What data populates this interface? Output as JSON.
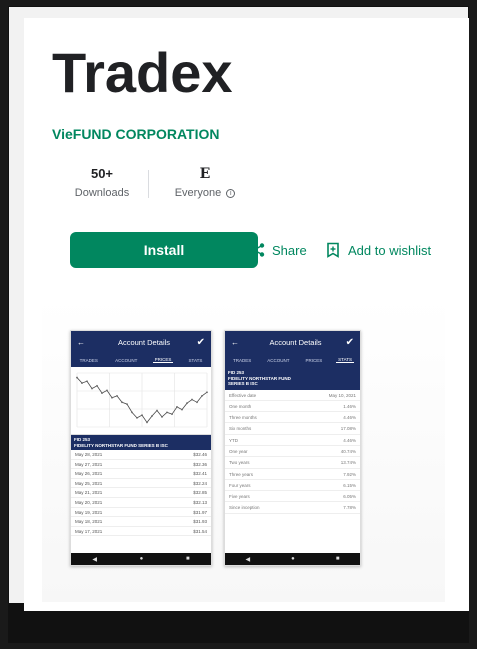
{
  "app": {
    "title": "Tradex",
    "developer": "VieFUND CORPORATION"
  },
  "stats": {
    "downloads_value": "50+",
    "downloads_label": "Downloads",
    "rating_badge": "E",
    "rating_label": "Everyone",
    "info_glyph": "i"
  },
  "actions": {
    "install_label": "Install",
    "share_label": "Share",
    "wishlist_label": "Add to wishlist"
  },
  "colors": {
    "accent": "#01875f",
    "phone_header": "#1c2e63"
  },
  "screenshots": {
    "prices": {
      "header_title": "Account Details",
      "back_glyph": "←",
      "check_glyph": "✔",
      "tabs": [
        "TRADES",
        "ACCOUNT",
        "PRICES",
        "STATS"
      ],
      "active_tab": "PRICES",
      "fund_line1": "FID 253",
      "fund_line2": "FIDELITY NORTHSTAR FUND SERIES B ISC",
      "rows": [
        {
          "date": "May 28, 2021",
          "price": "$32.46"
        },
        {
          "date": "May 27, 2021",
          "price": "$32.36"
        },
        {
          "date": "May 26, 2021",
          "price": "$32.41"
        },
        {
          "date": "May 25, 2021",
          "price": "$32.24"
        },
        {
          "date": "May 21, 2021",
          "price": "$32.85"
        },
        {
          "date": "May 20, 2021",
          "price": "$32.13"
        },
        {
          "date": "May 19, 2021",
          "price": "$31.97"
        },
        {
          "date": "May 18, 2021",
          "price": "$31.93"
        },
        {
          "date": "May 17, 2021",
          "price": "$31.54"
        }
      ],
      "chart_values": [
        34,
        33.4,
        33.6,
        32.8,
        33.1,
        32.3,
        32.6,
        31.8,
        32.0,
        31.3,
        31.1,
        30.2,
        29.6,
        29.9,
        29.1,
        29.8,
        30.4,
        29.7,
        30.2,
        30.0,
        30.8,
        30.5,
        31.2,
        31.6,
        31.3,
        32.0,
        32.4
      ]
    },
    "stats": {
      "header_title": "Account Details",
      "back_glyph": "←",
      "check_glyph": "✔",
      "tabs": [
        "TRADES",
        "ACCOUNT",
        "PRICES",
        "STATS"
      ],
      "active_tab": "STATS",
      "fund_line1": "FID 253",
      "fund_line2": "FIDELITY NORTHSTAR FUND",
      "fund_line3": "SERIES B ISC",
      "rows": [
        {
          "label": "Effective date",
          "value": "May 10, 2021"
        },
        {
          "label": "One month",
          "value": "1.46%"
        },
        {
          "label": "Three months",
          "value": "4.46%"
        },
        {
          "label": "Six months",
          "value": "17.08%"
        },
        {
          "label": "YTD",
          "value": "4.46%"
        },
        {
          "label": "One year",
          "value": "40.74%"
        },
        {
          "label": "Two years",
          "value": "13.74%"
        },
        {
          "label": "Three years",
          "value": "7.92%"
        },
        {
          "label": "Four years",
          "value": "6.15%"
        },
        {
          "label": "Five years",
          "value": "6.05%"
        },
        {
          "label": "Since inception",
          "value": "7.78%"
        }
      ]
    },
    "nav_glyphs": [
      "◀",
      "●",
      "■"
    ]
  }
}
